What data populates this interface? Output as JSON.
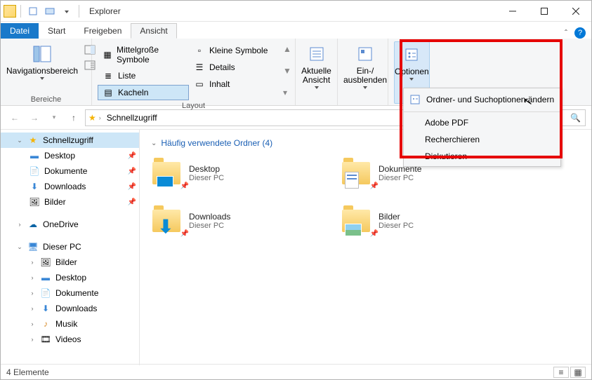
{
  "title": "Explorer",
  "tabs": {
    "file": "Datei",
    "start": "Start",
    "share": "Freigeben",
    "view": "Ansicht"
  },
  "ribbon": {
    "panes_label": "Bereiche",
    "nav_pane": "Navigationsbereich",
    "layout_label": "Layout",
    "layout_opts": {
      "medium": "Mittelgroße Symbole",
      "small": "Kleine Symbole",
      "list": "Liste",
      "details": "Details",
      "tiles": "Kacheln",
      "content": "Inhalt"
    },
    "current_view": "Aktuelle\nAnsicht",
    "show_hide": "Ein-/\nausblenden",
    "options": "Optionen"
  },
  "options_menu": {
    "change": "Ordner- und Suchoptionen ändern",
    "adobe": "Adobe PDF",
    "research": "Recherchieren",
    "discuss": "Diskutieren"
  },
  "addr": {
    "location": "Schnellzugriff"
  },
  "sidebar": {
    "quick": "Schnellzugriff",
    "desktop": "Desktop",
    "documents": "Dokumente",
    "downloads": "Downloads",
    "pictures": "Bilder",
    "onedrive": "OneDrive",
    "thispc": "Dieser PC",
    "pc_pictures": "Bilder",
    "pc_desktop": "Desktop",
    "pc_documents": "Dokumente",
    "pc_downloads": "Downloads",
    "pc_music": "Musik",
    "pc_videos": "Videos"
  },
  "content": {
    "heading": "Häufig verwendete Ordner (4)",
    "subtitle": "Dieser PC",
    "tiles": {
      "desktop": "Desktop",
      "documents": "Dokumente",
      "downloads": "Downloads",
      "pictures": "Bilder"
    }
  },
  "status": {
    "count": "4 Elemente"
  }
}
